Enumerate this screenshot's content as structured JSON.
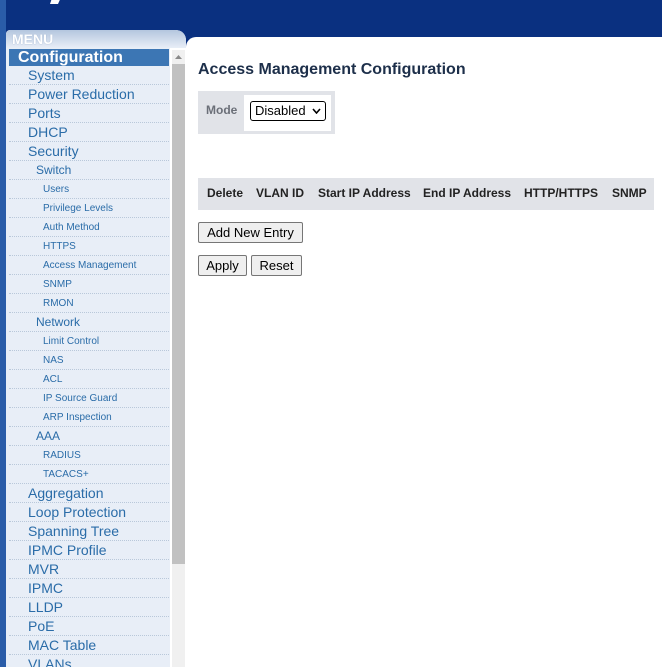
{
  "menu": {
    "header": "MENU",
    "items": [
      {
        "label": "Configuration",
        "level": "root"
      },
      {
        "label": "System",
        "level": 0
      },
      {
        "label": "Power Reduction",
        "level": 0
      },
      {
        "label": "Ports",
        "level": 0
      },
      {
        "label": "DHCP",
        "level": 0
      },
      {
        "label": "Security",
        "level": 0
      },
      {
        "label": "Switch",
        "level": 1
      },
      {
        "label": "Users",
        "level": 2
      },
      {
        "label": "Privilege Levels",
        "level": 2
      },
      {
        "label": "Auth Method",
        "level": 2
      },
      {
        "label": "HTTPS",
        "level": 2
      },
      {
        "label": "Access Management",
        "level": 2
      },
      {
        "label": "SNMP",
        "level": 2
      },
      {
        "label": "RMON",
        "level": 2
      },
      {
        "label": "Network",
        "level": 1
      },
      {
        "label": "Limit Control",
        "level": 2
      },
      {
        "label": "NAS",
        "level": 2
      },
      {
        "label": "ACL",
        "level": 2
      },
      {
        "label": "IP Source Guard",
        "level": 2
      },
      {
        "label": "ARP Inspection",
        "level": 2
      },
      {
        "label": "AAA",
        "level": 1
      },
      {
        "label": "RADIUS",
        "level": 2
      },
      {
        "label": "TACACS+",
        "level": 2
      },
      {
        "label": "Aggregation",
        "level": 0
      },
      {
        "label": "Loop Protection",
        "level": 0
      },
      {
        "label": "Spanning Tree",
        "level": 0
      },
      {
        "label": "IPMC Profile",
        "level": 0
      },
      {
        "label": "MVR",
        "level": 0
      },
      {
        "label": "IPMC",
        "level": 0
      },
      {
        "label": "LLDP",
        "level": 0
      },
      {
        "label": "PoE",
        "level": 0
      },
      {
        "label": "MAC Table",
        "level": 0
      },
      {
        "label": "VLANs",
        "level": 0
      }
    ]
  },
  "content": {
    "title": "Access Management Configuration",
    "mode_label": "Mode",
    "mode_value": "Disabled",
    "table_headers": [
      "Delete",
      "VLAN ID",
      "Start IP Address",
      "End IP Address",
      "HTTP/HTTPS",
      "SNMP"
    ],
    "add_entry_label": "Add New Entry",
    "apply_label": "Apply",
    "reset_label": "Reset"
  },
  "colors": {
    "header_bg": "#0a3080",
    "menu_bg": "#e8eef7",
    "menu_text": "#2a6ca8",
    "menu_selected": "#3c76b4",
    "table_header_bg": "#e1e3e8"
  }
}
